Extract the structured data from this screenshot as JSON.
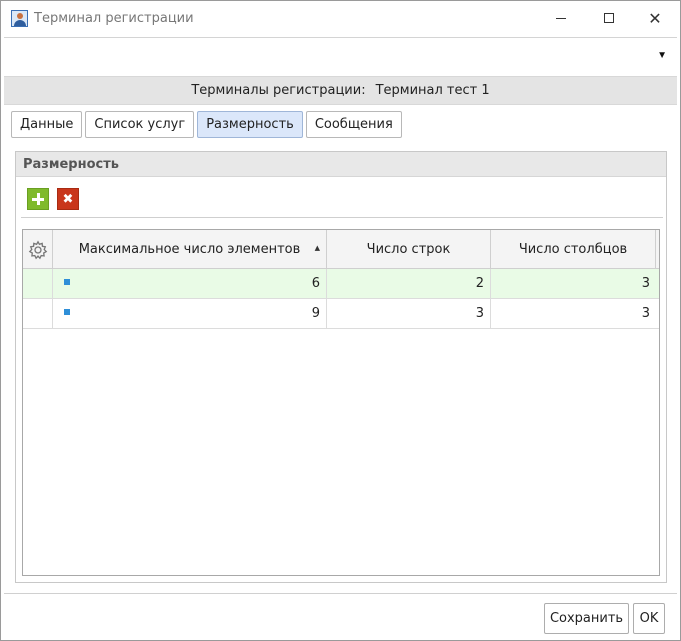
{
  "window": {
    "title": "Терминал регистрации",
    "icon": "user-icon"
  },
  "controls": {
    "minimize": "minimize-icon",
    "maximize": "maximize-icon",
    "close": "✕"
  },
  "header": {
    "label": "Терминалы регистрации:",
    "value": "Терминал тест 1"
  },
  "tabs": [
    {
      "label": "Данные"
    },
    {
      "label": "Список услуг"
    },
    {
      "label": "Размерность"
    },
    {
      "label": "Сообщения"
    }
  ],
  "active_tab": "Размерность",
  "panel": {
    "title": "Размерность",
    "add_icon": "plus-icon",
    "delete_icon": "x-icon",
    "delete_glyph": "✖"
  },
  "grid": {
    "settings_icon": "gear-icon",
    "columns": [
      "Максимальное число элементов",
      "Число строк",
      "Число столбцов"
    ],
    "sort_indicator": "▲",
    "rows": [
      {
        "max": "6",
        "rows": "2",
        "cols": "3",
        "selected": true
      },
      {
        "max": "9",
        "rows": "3",
        "cols": "3",
        "selected": false
      }
    ]
  },
  "buttons": {
    "save": "Сохранить",
    "ok": "OK"
  },
  "colors": {
    "add": "#7fba2c",
    "delete": "#c9361b",
    "active_tab": "#dbe7fa",
    "selected_row": "#e9fbe6",
    "row_marker": "#2f8fd8"
  }
}
